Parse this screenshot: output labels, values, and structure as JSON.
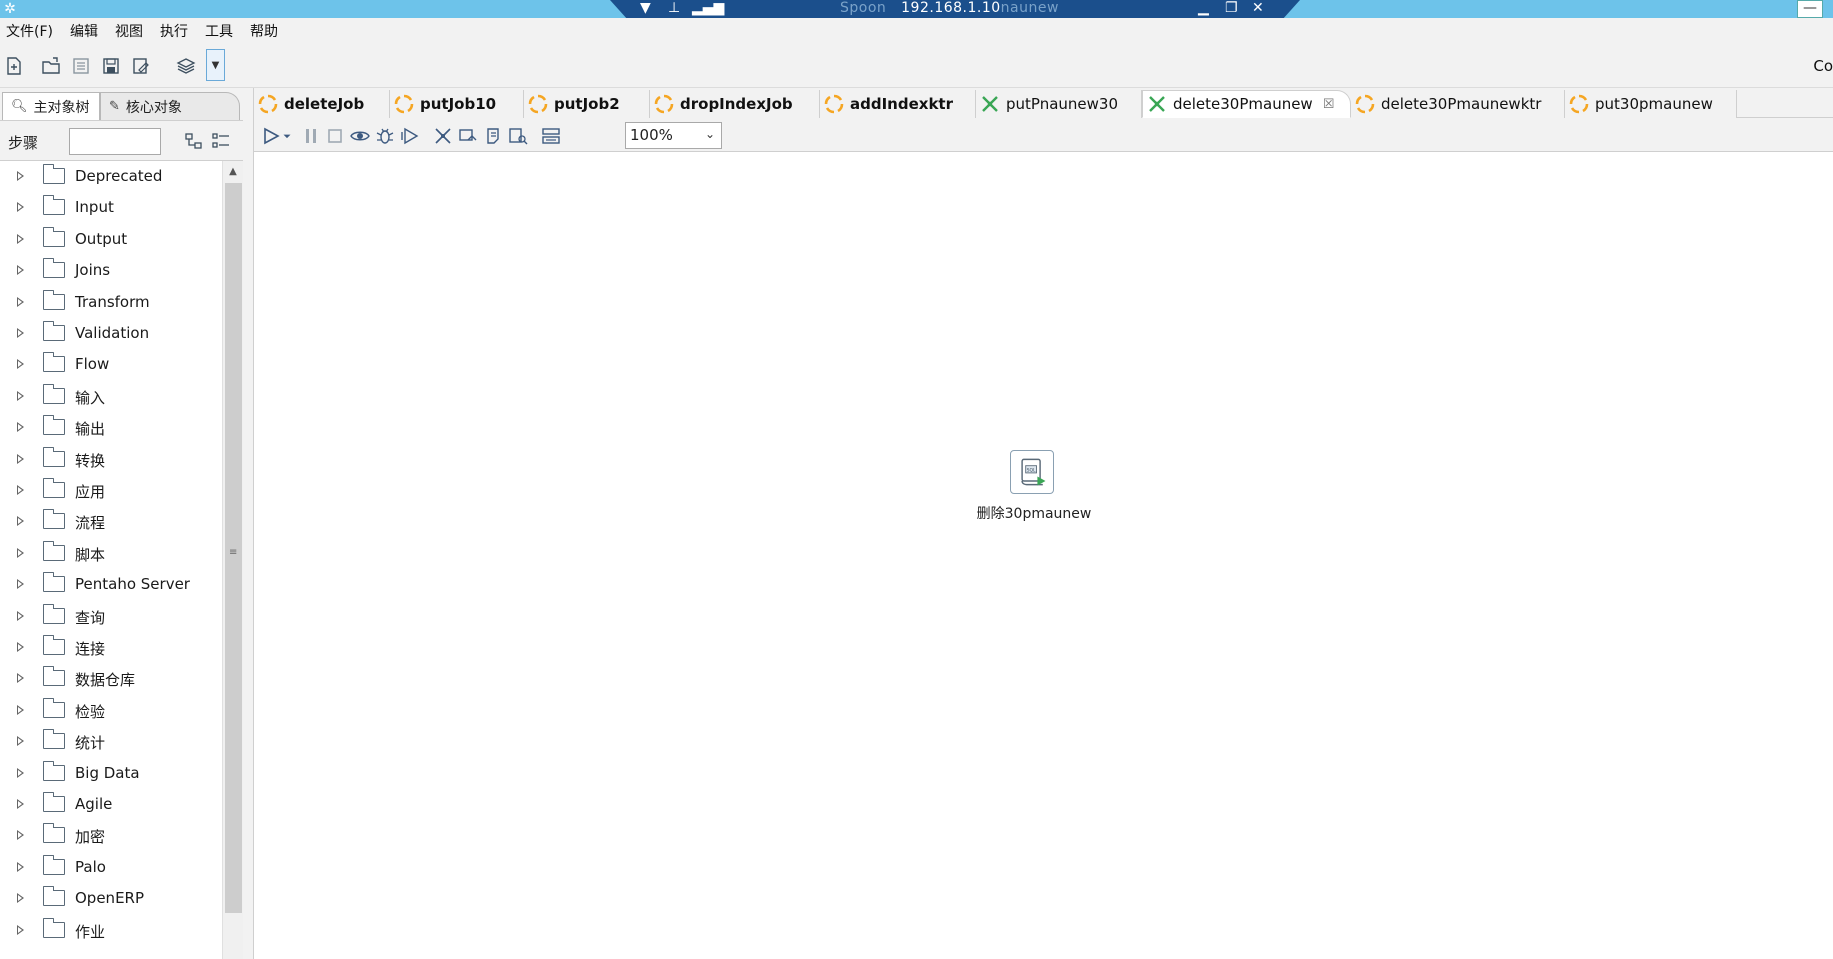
{
  "window": {
    "remote_title_main": "Spoon",
    "remote_title_ip": "192.168.1.10",
    "remote_title_tail": "naunew",
    "right_min": "—"
  },
  "menu": [
    "文件(F)",
    "编辑",
    "视图",
    "执行",
    "工具",
    "帮助"
  ],
  "toolbar": {
    "right_text": "Co"
  },
  "left_panel": {
    "tabs": [
      "主对象树",
      "核心对象"
    ],
    "steps_label": "步骤",
    "search_value": "",
    "tree_items": [
      "Deprecated",
      "Input",
      "Output",
      "Joins",
      "Transform",
      "Validation",
      "Flow",
      "输入",
      "输出",
      "转换",
      "应用",
      "流程",
      "脚本",
      "Pentaho Server",
      "查询",
      "连接",
      "数据仓库",
      "检验",
      "统计",
      "Big Data",
      "Agile",
      "加密",
      "Palo",
      "OpenERP",
      "作业"
    ]
  },
  "editor_tabs": [
    {
      "label": "deleteJob",
      "type": "job",
      "bold": true
    },
    {
      "label": "putJob10",
      "type": "job",
      "bold": true
    },
    {
      "label": "putJob2",
      "type": "job",
      "bold": true
    },
    {
      "label": "dropIndexJob",
      "type": "job",
      "bold": true
    },
    {
      "label": "addIndexktr",
      "type": "job",
      "bold": true
    },
    {
      "label": "putPnaunew30",
      "type": "trans",
      "bold": false
    },
    {
      "label": "delete30Pmaunew",
      "type": "trans",
      "bold": false,
      "active": true,
      "close": "☒"
    },
    {
      "label": "delete30Pmaunewktr",
      "type": "job",
      "bold": false
    },
    {
      "label": "put30pmaunew",
      "type": "job",
      "bold": false
    }
  ],
  "canvas_toolbar": {
    "zoom": "100%"
  },
  "canvas": {
    "step": {
      "label": "删除30pmaunew",
      "icon": "sql-script-icon"
    }
  },
  "colors": {
    "titlebar": "#6dc3ea",
    "remote_bar": "#1b4f8c",
    "job_icon": "#f5a623",
    "trans_icon": "#3aa655"
  }
}
